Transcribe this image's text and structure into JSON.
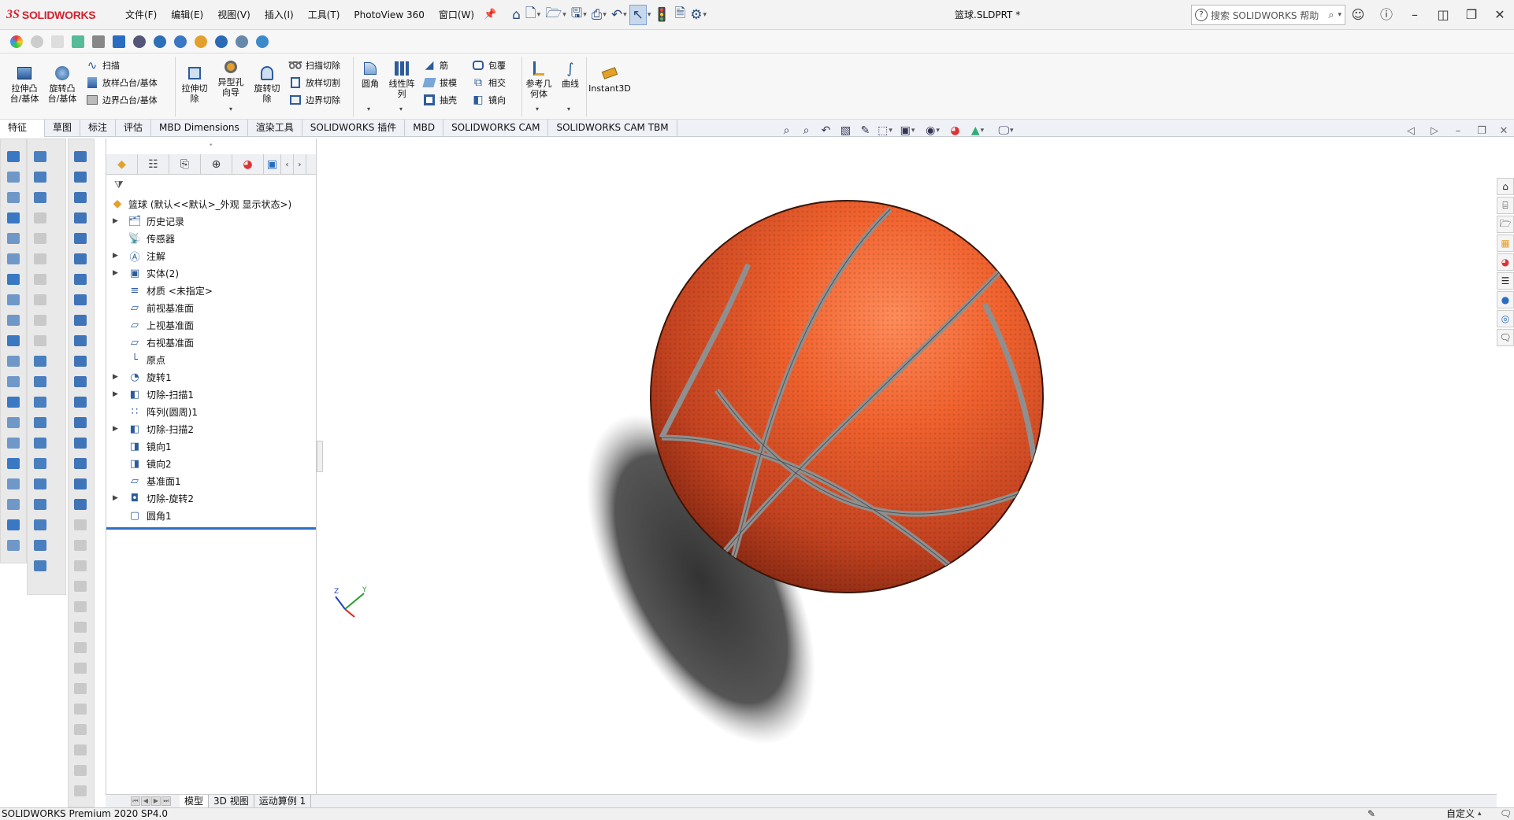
{
  "app": {
    "logo_mark": "3S",
    "logo_text": "SOLIDWORKS",
    "document_title": "篮球.SLDPRT *"
  },
  "menu": [
    "文件(F)",
    "编辑(E)",
    "视图(V)",
    "插入(I)",
    "工具(T)",
    "PhotoView 360",
    "窗口(W)"
  ],
  "search": {
    "placeholder": "搜索 SOLIDWORKS 帮助"
  },
  "command_manager": {
    "extrude_boss": "拉伸凸\n台/基体",
    "revolve_boss": "旋转凸\n台/基体",
    "sweep": "扫描",
    "loft_boss": "放样凸台/基体",
    "boundary_boss": "边界凸台/基体",
    "extrude_cut": "拉伸切\n除",
    "hole_wizard": "异型孔\n向导",
    "revolve_cut": "旋转切\n除",
    "swept_cut": "扫描切除",
    "loft_cut": "放样切割",
    "boundary_cut": "边界切除",
    "fillet": "圆角",
    "linear_pattern": "线性阵\n列",
    "rib": "筋",
    "draft": "拔模",
    "shell": "抽壳",
    "wrap": "包覆",
    "intersect": "相交",
    "mirror": "镜向",
    "reference_geometry": "参考几\n何体",
    "curves": "曲线",
    "instant3d": "Instant3D"
  },
  "tabs": [
    "特征",
    "草图",
    "标注",
    "评估",
    "MBD Dimensions",
    "渲染工具",
    "SOLIDWORKS 插件",
    "MBD",
    "SOLIDWORKS CAM",
    "SOLIDWORKS CAM TBM"
  ],
  "tree": {
    "root": "篮球  (默认<<默认>_外观 显示状态>)",
    "items": [
      {
        "label": "历史记录",
        "expand": true
      },
      {
        "label": "传感器",
        "expand": false
      },
      {
        "label": "注解",
        "expand": true
      },
      {
        "label": "实体(2)",
        "expand": true
      },
      {
        "label": "材质 <未指定>",
        "expand": false
      },
      {
        "label": "前视基准面",
        "expand": false
      },
      {
        "label": "上视基准面",
        "expand": false
      },
      {
        "label": "右视基准面",
        "expand": false
      },
      {
        "label": "原点",
        "expand": false
      },
      {
        "label": "旋转1",
        "expand": true
      },
      {
        "label": "切除-扫描1",
        "expand": true
      },
      {
        "label": "阵列(圆周)1",
        "expand": false
      },
      {
        "label": "切除-扫描2",
        "expand": true
      },
      {
        "label": "镜向1",
        "expand": false
      },
      {
        "label": "镜向2",
        "expand": false
      },
      {
        "label": "基准面1",
        "expand": false
      },
      {
        "label": "切除-旋转2",
        "expand": true
      },
      {
        "label": "圆角1",
        "expand": false
      }
    ]
  },
  "bottom_tabs": [
    "模型",
    "3D 视图",
    "运动算例 1"
  ],
  "status": {
    "version": "SOLIDWORKS Premium 2020 SP4.0",
    "units": "自定义"
  },
  "colors": {
    "brand_red": "#d3232f",
    "ball_orange": "#e85a2a",
    "seam_grey": "#9a9a9a",
    "selection_blue": "#2f6fc5"
  }
}
